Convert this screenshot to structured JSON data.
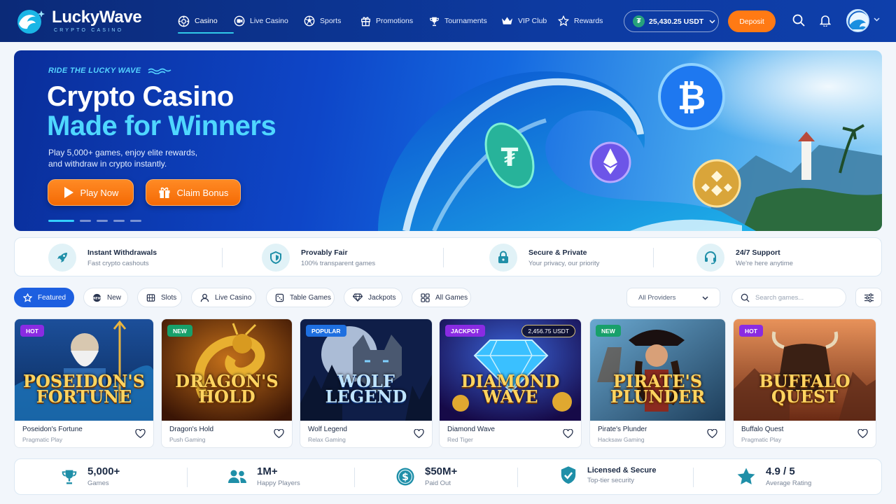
{
  "header": {
    "logo_title": "LuckyWave",
    "logo_sub": "CRYPTO CASINO",
    "nav": [
      {
        "label": "Casino",
        "icon": "chip-icon"
      },
      {
        "label": "Live Casino",
        "icon": "live-icon"
      },
      {
        "label": "Sports",
        "icon": "ball-icon"
      },
      {
        "label": "Promotions",
        "icon": "gift-icon"
      },
      {
        "label": "Tournaments",
        "icon": "trophy-icon"
      },
      {
        "label": "VIP Club",
        "icon": "crown-icon"
      },
      {
        "label": "Rewards",
        "icon": "star-icon"
      }
    ],
    "balance": "25,430.25 USDT",
    "deposit": "Deposit"
  },
  "hero": {
    "tagline": "RIDE THE LUCKY WAVE",
    "title_1": "Crypto Casino",
    "title_2": "Made for Winners",
    "desc_1": "Play 5,000+ games, enjoy elite rewards,",
    "desc_2": "and withdraw in crypto instantly.",
    "play_btn": "Play Now",
    "bonus_btn": "Claim Bonus"
  },
  "features": [
    {
      "title": "Instant Withdrawals",
      "sub": "Fast crypto cashouts",
      "icon": "rocket-icon"
    },
    {
      "title": "Provably Fair",
      "sub": "100% transparent games",
      "icon": "shield-icon"
    },
    {
      "title": "Secure & Private",
      "sub": "Your privacy, our priority",
      "icon": "lock-icon"
    },
    {
      "title": "24/7 Support",
      "sub": "We're here anytime",
      "icon": "headset-icon"
    }
  ],
  "filters": {
    "chips": [
      "Featured",
      "New",
      "Slots",
      "Live Casino",
      "Table Games",
      "Jackpots",
      "All Games"
    ],
    "providers": "All Providers",
    "search_placeholder": "Search games..."
  },
  "games": [
    {
      "name": "Poseidon's Fortune",
      "provider": "Pragmatic Play",
      "badge": "HOT",
      "art_l1": "POSEIDON'S",
      "art_l2": "FORTUNE"
    },
    {
      "name": "Dragon's Hold",
      "provider": "Push Gaming",
      "badge": "NEW",
      "art_l1": "DRAGON'S",
      "art_l2": "HOLD"
    },
    {
      "name": "Wolf Legend",
      "provider": "Relax Gaming",
      "badge": "POPULAR",
      "art_l1": "WOLF",
      "art_l2": "LEGEND"
    },
    {
      "name": "Diamond Wave",
      "provider": "Red Tiger",
      "badge": "JACKPOT",
      "jackpot": "2,456.75 USDT",
      "art_l1": "DIAMOND",
      "art_l2": "WAVE"
    },
    {
      "name": "Pirate's Plunder",
      "provider": "Hacksaw Gaming",
      "badge": "NEW",
      "art_l1": "PIRATE'S",
      "art_l2": "PLUNDER"
    },
    {
      "name": "Buffalo Quest",
      "provider": "Pragmatic Play",
      "badge": "HOT",
      "art_l1": "BUFFALO",
      "art_l2": "QUEST"
    }
  ],
  "stats": [
    {
      "value": "5,000+",
      "label": "Games",
      "icon": "trophy-icon"
    },
    {
      "value": "1M+",
      "label": "Happy Players",
      "icon": "users-icon"
    },
    {
      "value": "$50M+",
      "label": "Paid Out",
      "icon": "dollar-icon"
    },
    {
      "value": "Licensed & Secure",
      "label": "Top-tier security",
      "icon": "shield-check-icon"
    },
    {
      "value": "4.9 / 5",
      "label": "Average Rating",
      "icon": "star-icon"
    }
  ],
  "colors": {
    "brand": "#0d3aa0",
    "accent": "#ff7a14",
    "active": "#1d5fe0",
    "cyan": "#4fd7ff"
  }
}
